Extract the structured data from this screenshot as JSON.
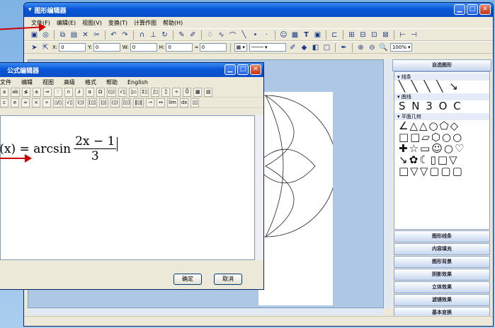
{
  "main_window": {
    "title": "图形编辑器",
    "menu": [
      "文件(F)",
      "编辑(E)",
      "视图(V)",
      "变换(T)",
      "计算作图",
      "帮助(H)"
    ],
    "coords": {
      "x_label": "X:",
      "x_value": "0",
      "y_label": "Y:",
      "y_value": "0",
      "w_label": "W:",
      "w_value": "0",
      "h_label": "H:",
      "h_value": "0",
      "line_width": "0"
    },
    "zoom": "100%"
  },
  "right_panel": {
    "header": "自选图形",
    "categories": [
      "线条",
      "曲线",
      "平面几何"
    ],
    "sections": [
      "图形线条",
      "内容填充",
      "图形背景",
      "阴影效果",
      "立体效果",
      "滤镜效果",
      "基本变换"
    ]
  },
  "formula_window": {
    "title": "公式编辑器",
    "menu": [
      "文件",
      "编辑",
      "视图",
      "高级",
      "格式",
      "帮助",
      "English"
    ],
    "formula_lhs": "f(x) = arcsin",
    "numerator": "2x − 1",
    "denominator": "3",
    "ok_label": "确定",
    "cancel_label": "取消"
  }
}
